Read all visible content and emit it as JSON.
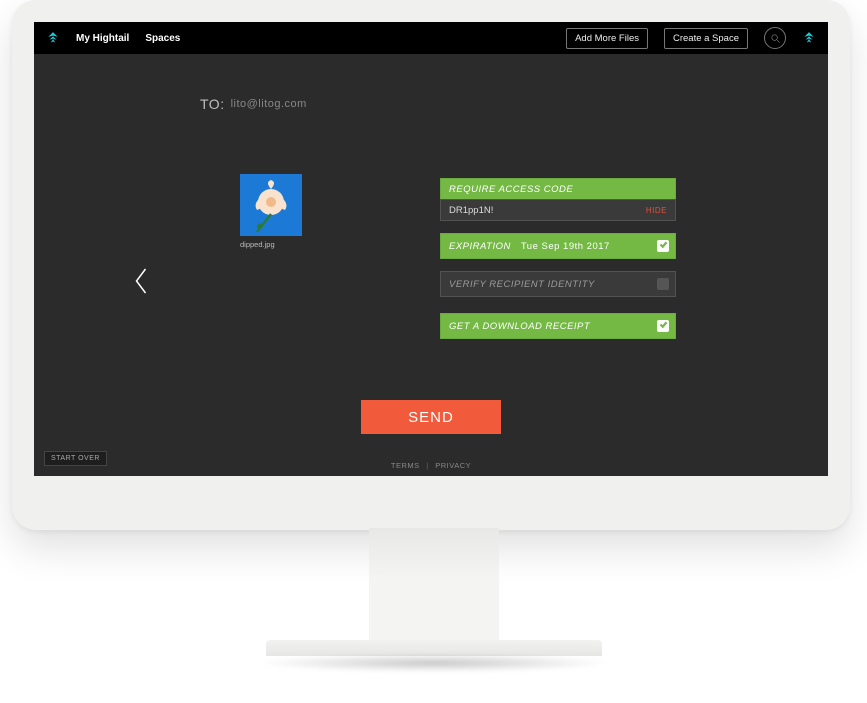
{
  "nav": {
    "my_hightail": "My Hightail",
    "spaces": "Spaces",
    "add_more_files": "Add More Files",
    "create_space": "Create a Space"
  },
  "to": {
    "label": "TO:",
    "email": "lito@litog.com"
  },
  "file": {
    "name": "dipped.jpg"
  },
  "options": {
    "access_code_label": "REQUIRE ACCESS CODE",
    "access_code_value": "DR1pp1N!",
    "hide_label": "HIDE",
    "expiration_label": "EXPIRATION",
    "expiration_value": "Tue Sep 19th 2017",
    "verify_label": "VERIFY RECIPIENT IDENTITY",
    "receipt_label": "GET A DOWNLOAD RECEIPT"
  },
  "actions": {
    "send": "SEND",
    "start_over": "START OVER"
  },
  "footer": {
    "terms": "TERMS",
    "privacy": "PRIVACY"
  },
  "colors": {
    "accent_green": "#74b944",
    "accent_orange": "#f25a3c",
    "brand_cyan": "#1fc7d4"
  }
}
